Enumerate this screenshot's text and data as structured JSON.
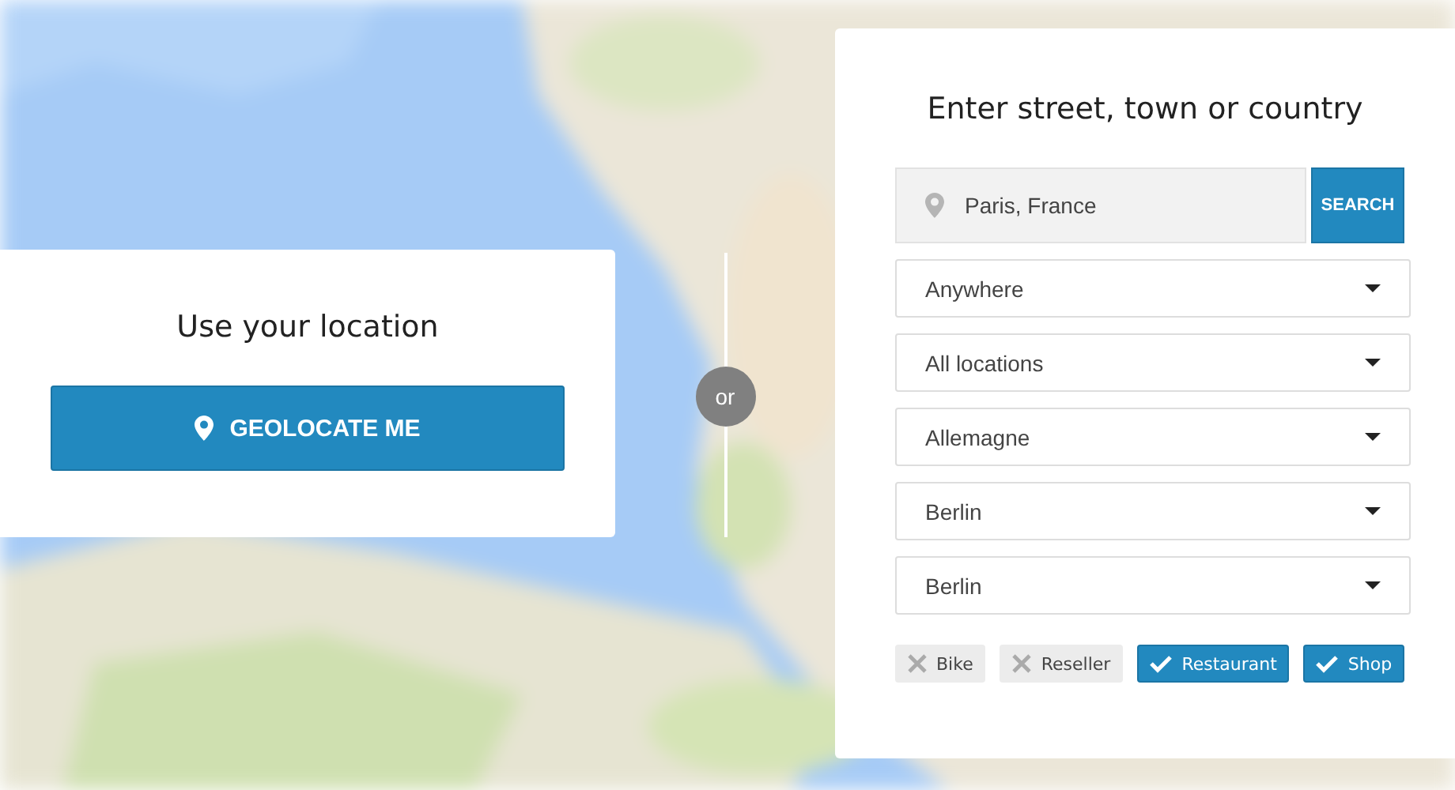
{
  "geolocate": {
    "title": "Use your location",
    "button": "GEOLOCATE ME"
  },
  "divider": {
    "label": "or"
  },
  "search_panel": {
    "title": "Enter street, town or country",
    "search_field": {
      "value": "Paris, France"
    },
    "search_button": "SEARCH",
    "dropdowns": [
      "Anywhere",
      "All locations",
      "Allemagne",
      "Berlin",
      "Berlin"
    ],
    "tags": [
      {
        "label": "Bike",
        "checked": false
      },
      {
        "label": "Reseller",
        "checked": false
      },
      {
        "label": "Restaurant",
        "checked": true
      },
      {
        "label": "Shop",
        "checked": true
      }
    ]
  }
}
